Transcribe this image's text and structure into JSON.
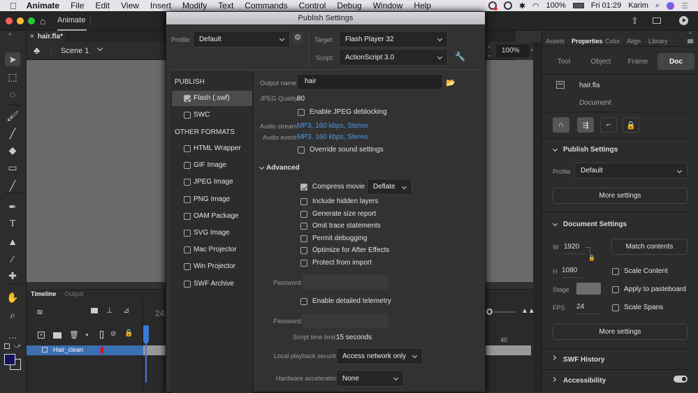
{
  "menubar": {
    "app": "Animate",
    "items": [
      "File",
      "Edit",
      "View",
      "Insert",
      "Modify",
      "Text",
      "Commands",
      "Control",
      "Debug",
      "Window",
      "Help"
    ],
    "battery": "100%",
    "clock": "Fri 01:29",
    "user": "Karim"
  },
  "app": {
    "home_tab": "Animate",
    "doc_tab": "hair.fla*",
    "scene": "Scene 1",
    "zoom": "100%"
  },
  "dialog": {
    "title": "Publish Settings",
    "profile_label": "Profile:",
    "profile_value": "Default",
    "target_label": "Target:",
    "target_value": "Flash Player 32",
    "script_label": "Script:",
    "script_value": "ActionScript 3.0",
    "publish_heading": "PUBLISH",
    "publish_items": [
      {
        "label": "Flash (.swf)",
        "checked": true
      },
      {
        "label": "SWC",
        "checked": false
      }
    ],
    "other_heading": "OTHER FORMATS",
    "other_items": [
      {
        "label": "HTML Wrapper",
        "checked": false
      },
      {
        "label": "GIF Image",
        "checked": false
      },
      {
        "label": "JPEG Image",
        "checked": false
      },
      {
        "label": "PNG Image",
        "checked": false
      },
      {
        "label": "OAM Package",
        "checked": false
      },
      {
        "label": "SVG Image",
        "checked": false
      },
      {
        "label": "Mac Projector",
        "checked": false
      },
      {
        "label": "Win Projector",
        "checked": false
      },
      {
        "label": "SWF Archive",
        "checked": false
      }
    ],
    "output_name_label": "Output name:",
    "output_name_value": "hair",
    "jpeg_quality_label": "JPEG Quality:",
    "jpeg_quality_value": "80",
    "jpeg_deblocking": "Enable JPEG deblocking",
    "audio_stream_label": "Audio stream:",
    "audio_stream_value": "MP3, 160 kbps, Stereo",
    "audio_event_label": "Audio event:",
    "audio_event_value": "MP3, 160 kbps, Stereo",
    "override_sound": "Override sound settings",
    "advanced_label": "Advanced",
    "compress_movie": "Compress movie",
    "compress_value": "Deflate",
    "advanced_options": [
      {
        "label": "Include hidden layers",
        "checked": false
      },
      {
        "label": "Generate size report",
        "checked": false
      },
      {
        "label": "Omit trace statements",
        "checked": false
      },
      {
        "label": "Permit debugging",
        "checked": false
      },
      {
        "label": "Optimize for After Effects",
        "checked": false
      },
      {
        "label": "Protect from import",
        "checked": false
      }
    ],
    "password_label": "Password:",
    "telemetry": "Enable detailed telemetry",
    "script_time_label": "Script time limit:",
    "script_time_value": "15 seconds",
    "playback_security_label": "Local playback security:",
    "playback_security_value": "Access network only",
    "hw_accel_label": "Hardware acceleration:",
    "hw_accel_value": "None"
  },
  "timeline": {
    "tabs": [
      "Timeline",
      "Output"
    ],
    "fps_display": "24.",
    "layer_name": "Hair_clean",
    "frame_marker": "40"
  },
  "properties": {
    "tabs": [
      "Assets",
      "Properties",
      "Color",
      "Align",
      "Library"
    ],
    "active_tab": "Properties",
    "mode_tabs": [
      "Tool",
      "Object",
      "Frame",
      "Doc"
    ],
    "active_mode": "Doc",
    "doc_name": "hair.fla",
    "doc_type": "Document",
    "publish_section": "Publish Settings",
    "profile_label": "Profile",
    "profile_value": "Default",
    "more_settings": "More settings",
    "document_section": "Document Settings",
    "w_label": "W",
    "w_value": "1920",
    "h_label": "H",
    "h_value": "1080",
    "match_contents": "Match contents",
    "scale_content": "Scale Content",
    "stage_label": "Stage",
    "apply_pasteboard": "Apply to pasteboard",
    "fps_label": "FPS",
    "fps_value": "24",
    "scale_spans": "Scale Spans",
    "more_settings_2": "More settings",
    "swf_history": "SWF History",
    "accessibility": "Accessibility",
    "stage_color": "#6e6e6e"
  }
}
